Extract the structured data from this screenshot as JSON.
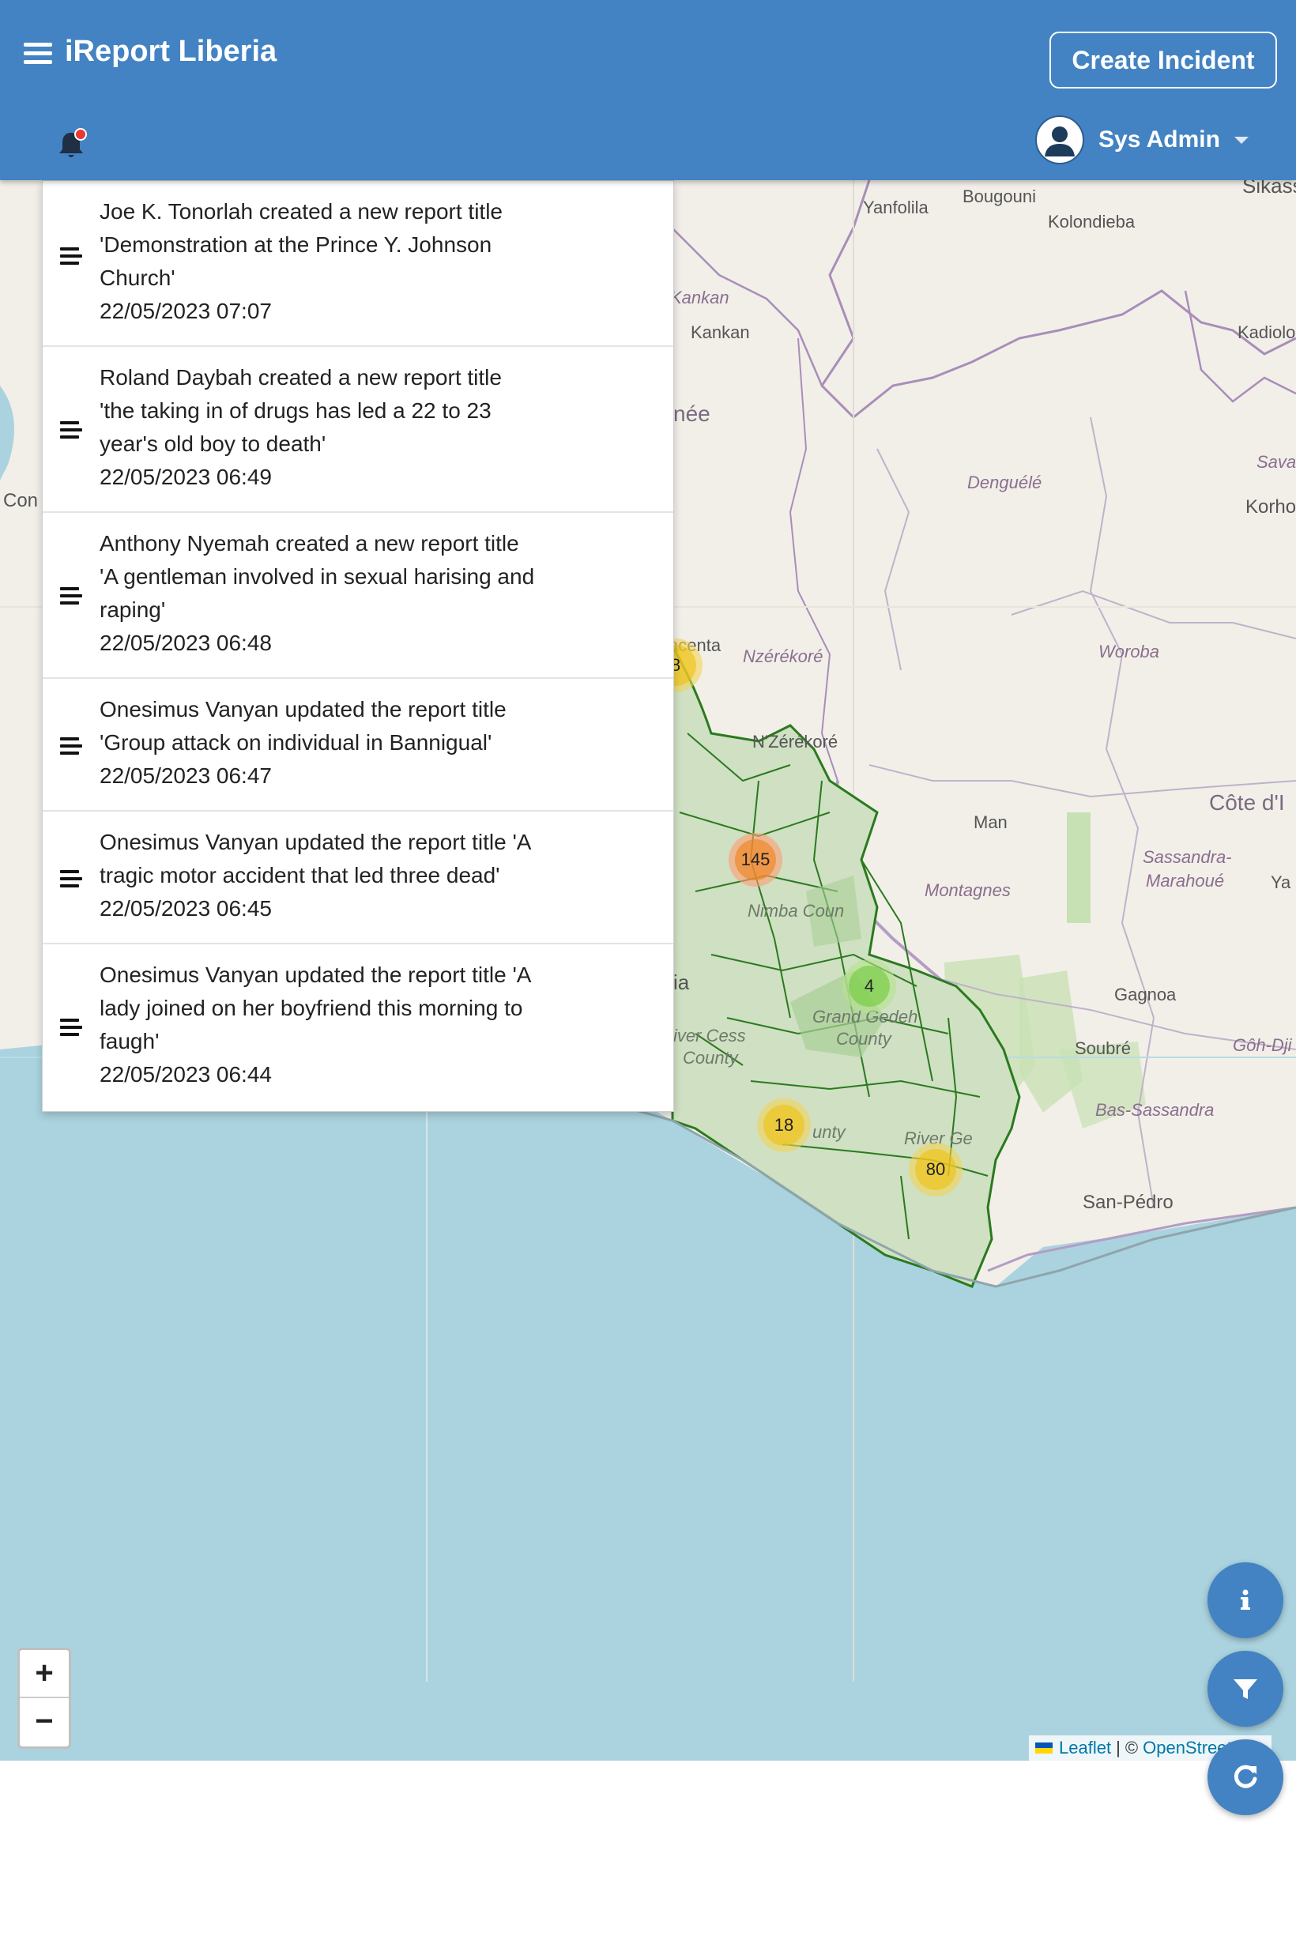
{
  "header": {
    "menu_icon": "hamburger-menu-icon",
    "brand": "iReport Liberia",
    "create_button": "Create Incident",
    "bell_icon": "bell-icon",
    "user_icon": "user-avatar-icon",
    "user_name": "Sys Admin",
    "colors": {
      "primary": "#4383c3",
      "badge": "#e53935"
    }
  },
  "notifications": [
    {
      "text": "Joe K. Tonorlah  created a new report title 'Demonstration at the Prince Y. Johnson Church'",
      "time": "22/05/2023 07:07"
    },
    {
      "text": "Roland Daybah created a new report title 'the taking in of drugs has led a 22 to 23 year's old boy to death'",
      "time": "22/05/2023 06:49"
    },
    {
      "text": "Anthony Nyemah created a new report title 'A gentleman involved in sexual harising and raping'",
      "time": "22/05/2023 06:48"
    },
    {
      "text": "Onesimus Vanyan  updated the report title 'Group attack on individual in Bannigual'",
      "time": "22/05/2023 06:47"
    },
    {
      "text": "Onesimus Vanyan  updated the report title 'A tragic motor accident that led three dead'",
      "time": "22/05/2023 06:45"
    },
    {
      "text": "Onesimus Vanyan  updated the report title 'A lady joined on her boyfriend this morning to faugh'",
      "time": "22/05/2023 06:44"
    }
  ],
  "map": {
    "labels": {
      "yanfolila": "Yanfolila",
      "bougouni": "Bougouni",
      "kolondieba": "Kolondieba",
      "sikasso": "Sikass",
      "kankan_it": "Kankan",
      "kankan": "Kankan",
      "kadiolo": "Kadiolo",
      "guinee": "née",
      "denguele": "Denguélé",
      "sava": "Sava",
      "korhogo": "Korho",
      "con": "Con",
      "macenta": "acenta",
      "nzerekore_it": "Nzérékoré",
      "nzerekore": "N'Zérékoré",
      "woroba": "Woroba",
      "cote": "Côte d'I",
      "man": "Man",
      "montagnes": "Montagnes",
      "sassandra": "Sassandra-",
      "marahoue": "Marahoué",
      "ya": "Ya",
      "nimba": "Nimba Coun",
      "ia": "ia",
      "gagnoa": "Gagnoa",
      "grand_gedeh": "Grand Gedeh",
      "county1": "County",
      "river_cess": "iver Cess",
      "county2": "County",
      "soubre": "Soubré",
      "goh": "Gôh-Dji",
      "bas_sassandra": "Bas-Sassandra",
      "unty": "unty",
      "river_ge": "River Ge",
      "san_pedro": "San-Pédro"
    },
    "clusters": [
      {
        "label": "8"
      },
      {
        "label": "145"
      },
      {
        "label": "4"
      },
      {
        "label": "18"
      },
      {
        "label": "80"
      }
    ],
    "zoom_in": "+",
    "zoom_out": "−",
    "attribution_leaflet": "Leaflet",
    "attribution_sep": "| ©",
    "attribution_osm": "OpenStreetMap"
  },
  "fabs": {
    "info_icon": "info-icon",
    "filter_icon": "filter-icon",
    "refresh_icon": "refresh-icon"
  }
}
